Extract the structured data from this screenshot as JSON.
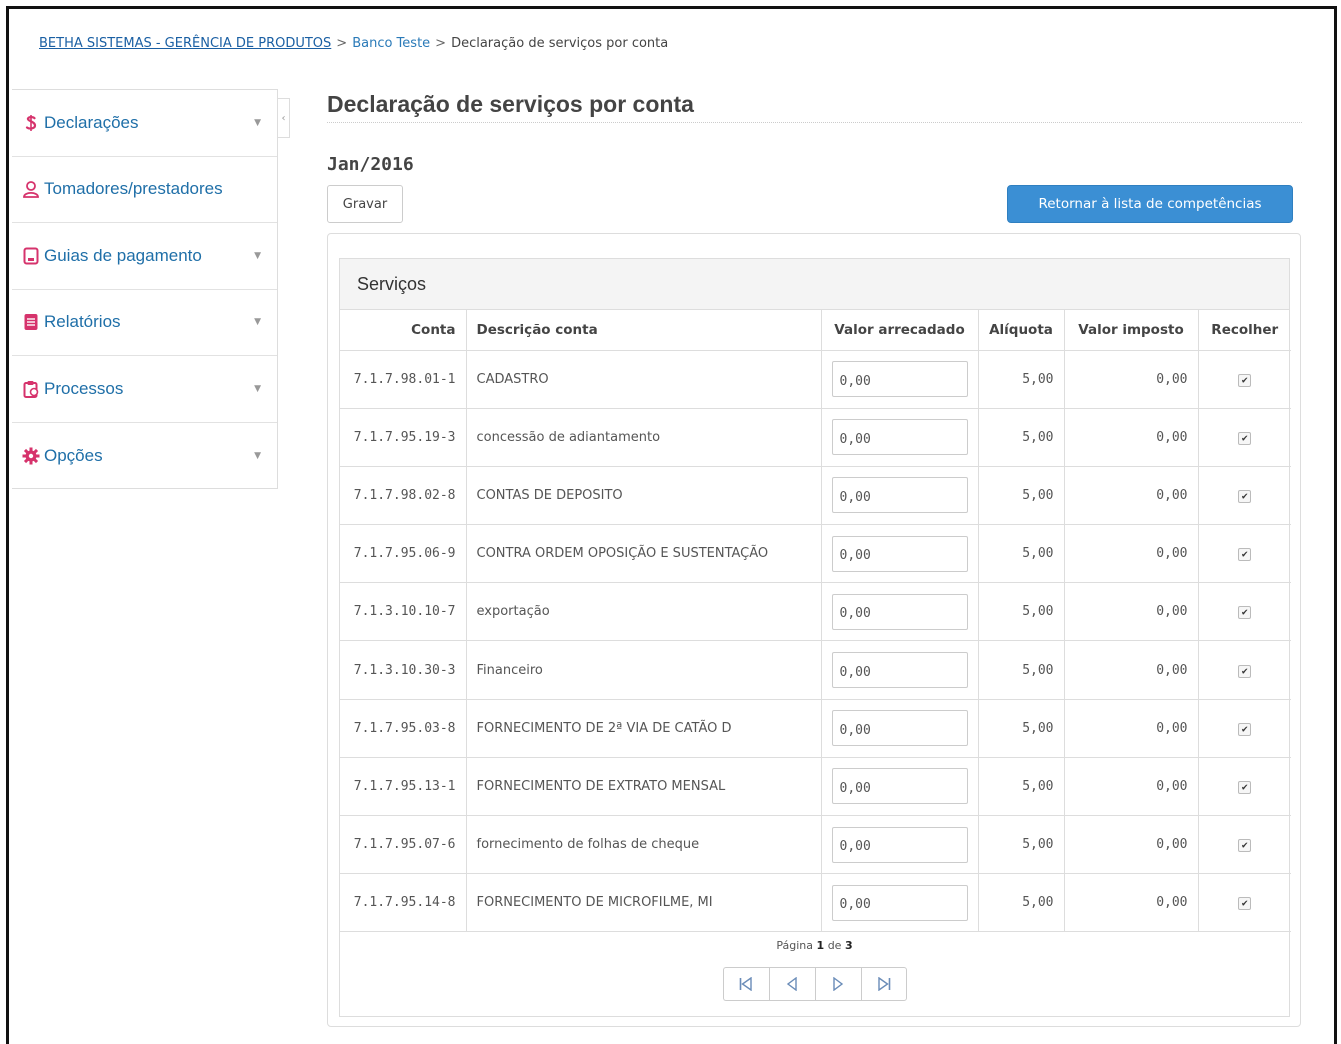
{
  "breadcrumb": {
    "root": "BETHA SISTEMAS - GERÊNCIA DE PRODUTOS",
    "link": "Banco Teste",
    "current": "Declaração de serviços por conta",
    "separator": ">"
  },
  "sidebar": {
    "items": [
      {
        "label": "Declarações",
        "icon": "dollar-icon",
        "has_caret": true
      },
      {
        "label": "Tomadores/prestadores",
        "icon": "user-icon",
        "has_caret": false
      },
      {
        "label": "Guias de pagamento",
        "icon": "tablet-icon",
        "has_caret": true
      },
      {
        "label": "Relatórios",
        "icon": "report-icon",
        "has_caret": true
      },
      {
        "label": "Processos",
        "icon": "clipboard-icon",
        "has_caret": true
      },
      {
        "label": "Opções",
        "icon": "gear-icon",
        "has_caret": true
      }
    ],
    "caret": "▼",
    "collapse": "‹"
  },
  "main": {
    "title": "Declaração de serviços por conta",
    "period": "Jan/2016",
    "save_label": "Gravar",
    "return_label": "Retornar à lista de competências"
  },
  "panel": {
    "title": "Serviços",
    "columns": [
      "Conta",
      "Descrição conta",
      "Valor arrecadado",
      "Alíquota",
      "Valor imposto",
      "Recolher"
    ],
    "rows": [
      {
        "conta": "7.1.7.98.01-1",
        "descricao": "CADASTRO",
        "valor": "0,00",
        "aliquota": "5,00",
        "imposto": "0,00",
        "recolher": true
      },
      {
        "conta": "7.1.7.95.19-3",
        "descricao": "concessão de adiantamento",
        "valor": "0,00",
        "aliquota": "5,00",
        "imposto": "0,00",
        "recolher": true
      },
      {
        "conta": "7.1.7.98.02-8",
        "descricao": "CONTAS DE DEPOSITO",
        "valor": "0,00",
        "aliquota": "5,00",
        "imposto": "0,00",
        "recolher": true
      },
      {
        "conta": "7.1.7.95.06-9",
        "descricao": "CONTRA ORDEM OPOSIÇÃO E SUSTENTAÇÃO",
        "valor": "0,00",
        "aliquota": "5,00",
        "imposto": "0,00",
        "recolher": true
      },
      {
        "conta": "7.1.3.10.10-7",
        "descricao": "exportação",
        "valor": "0,00",
        "aliquota": "5,00",
        "imposto": "0,00",
        "recolher": true
      },
      {
        "conta": "7.1.3.10.30-3",
        "descricao": "Financeiro",
        "valor": "0,00",
        "aliquota": "5,00",
        "imposto": "0,00",
        "recolher": true
      },
      {
        "conta": "7.1.7.95.03-8",
        "descricao": "FORNECIMENTO DE 2ª VIA DE CATÃO D",
        "valor": "0,00",
        "aliquota": "5,00",
        "imposto": "0,00",
        "recolher": true
      },
      {
        "conta": "7.1.7.95.13-1",
        "descricao": "FORNECIMENTO DE EXTRATO MENSAL",
        "valor": "0,00",
        "aliquota": "5,00",
        "imposto": "0,00",
        "recolher": true
      },
      {
        "conta": "7.1.7.95.07-6",
        "descricao": "fornecimento de folhas de cheque",
        "valor": "0,00",
        "aliquota": "5,00",
        "imposto": "0,00",
        "recolher": true
      },
      {
        "conta": "7.1.7.95.14-8",
        "descricao": "FORNECIMENTO DE MICROFILME, MI",
        "valor": "0,00",
        "aliquota": "5,00",
        "imposto": "0,00",
        "recolher": true
      }
    ],
    "check_glyph": "✔"
  },
  "pagination": {
    "page_word": "Página",
    "current": "1",
    "of_word": "de",
    "total": "3"
  },
  "colors": {
    "link": "#1f6fa8",
    "primary_button": "#3b8fd4",
    "icon_red": "#d6336c"
  }
}
